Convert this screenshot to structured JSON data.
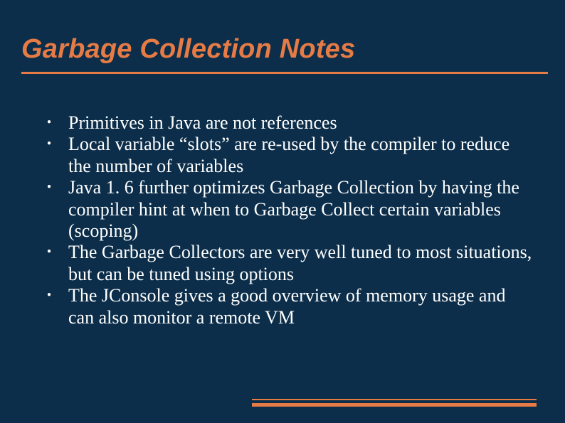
{
  "slide": {
    "title": "Garbage Collection Notes",
    "bullets": [
      "Primitives in Java are not references",
      "Local variable “slots” are re-used by the compiler to reduce the number of variables",
      "Java 1. 6 further optimizes Garbage Collection by having the compiler hint at when to Garbage Collect certain variables (scoping)",
      "The Garbage Collectors are very well tuned to most situations, but can be tuned using options",
      "The JConsole gives a good overview of memory usage and can also monitor a remote VM"
    ]
  },
  "colors": {
    "background": "#0c2e4a",
    "accent": "#e67b45",
    "text": "#ffffff"
  }
}
